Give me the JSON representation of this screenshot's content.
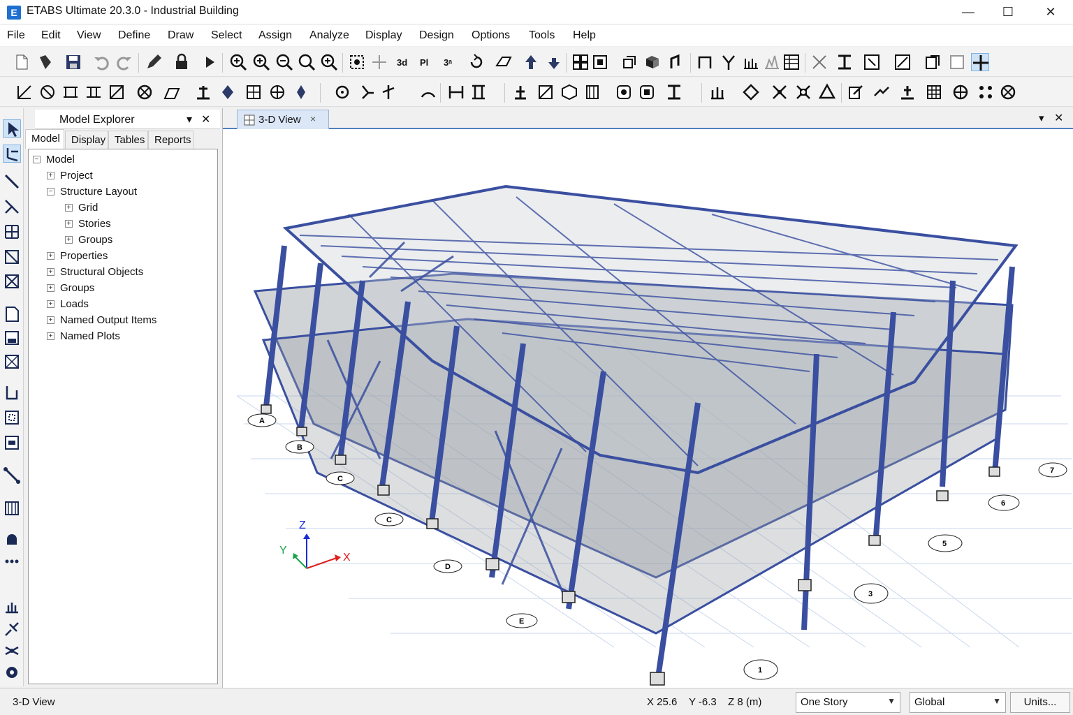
{
  "window": {
    "title": "ETABS Ultimate 20.3.0 - Industrial Building",
    "logo_letter": "E",
    "controls": {
      "minimize": "—",
      "maximize": "☐",
      "close": "✕"
    }
  },
  "menu": [
    "File",
    "Edit",
    "View",
    "Define",
    "Draw",
    "Select",
    "Assign",
    "Analyze",
    "Display",
    "Design",
    "Options",
    "Tools",
    "Help"
  ],
  "explorer": {
    "title": "Model Explorer",
    "pin": "▾",
    "close": "✕",
    "tabs": [
      "Model",
      "Display",
      "Tables",
      "Reports"
    ],
    "tree": {
      "root": "Model",
      "items": [
        {
          "label": "Project",
          "expander": "+"
        },
        {
          "label": "Structure Layout",
          "expander": "−"
        },
        {
          "label": "Grid",
          "expander": "+"
        },
        {
          "label": "Stories",
          "expander": "+"
        },
        {
          "label": "Groups",
          "expander": "+"
        },
        {
          "label": "Properties",
          "expander": "+"
        },
        {
          "label": "Structural Objects",
          "expander": "+"
        },
        {
          "label": "Groups",
          "expander": "+"
        },
        {
          "label": "Loads",
          "expander": "+"
        },
        {
          "label": "Named Output Items",
          "expander": "+"
        },
        {
          "label": "Named Plots",
          "expander": "+"
        }
      ]
    }
  },
  "view": {
    "tab_label": "3-D View",
    "tab_close": "×",
    "pin": "▾",
    "close": "✕",
    "axes": {
      "x": "X",
      "y": "Y",
      "z": "Z"
    },
    "grid_bubbles_letters": [
      "A",
      "B",
      "C",
      "C",
      "D",
      "E"
    ],
    "grid_bubbles_numbers": [
      "1",
      "3",
      "5",
      "6",
      "7"
    ]
  },
  "status": {
    "left": "3-D View",
    "x": "X 25.6",
    "y": "Y -6.3",
    "z": "Z 8 (m)",
    "story": "One Story",
    "coord_system": "Global",
    "units": "Units..."
  },
  "colors": {
    "accent": "#1f6fd1",
    "frame": "#3a4fa0",
    "slab": "#9aa0a6"
  }
}
